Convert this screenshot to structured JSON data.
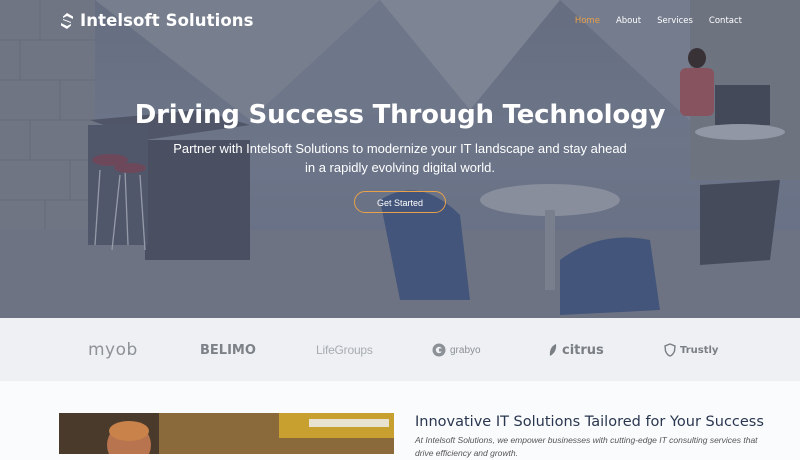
{
  "brand": {
    "name": "Intelsoft Solutions",
    "logo_icon": "s-mark-icon"
  },
  "nav": {
    "items": [
      {
        "label": "Home",
        "active": true
      },
      {
        "label": "About",
        "active": false
      },
      {
        "label": "Services",
        "active": false
      },
      {
        "label": "Contact",
        "active": false
      }
    ]
  },
  "hero": {
    "title": "Driving Success Through Technology",
    "subtitle": "Partner with Intelsoft Solutions to modernize your IT landscape and stay ahead in a rapidly evolving digital world.",
    "cta_label": "Get Started"
  },
  "clients": [
    "myob",
    "BELIMO",
    "LifeGroups",
    "grabyo",
    "citrus",
    "Trustly"
  ],
  "section": {
    "title": "Innovative IT Solutions Tailored for Your Success",
    "text": "At Intelsoft Solutions, we empower businesses with cutting-edge IT consulting services that drive efficiency and growth."
  },
  "colors": {
    "accent": "#e9a04a",
    "heading": "#2a3750"
  }
}
